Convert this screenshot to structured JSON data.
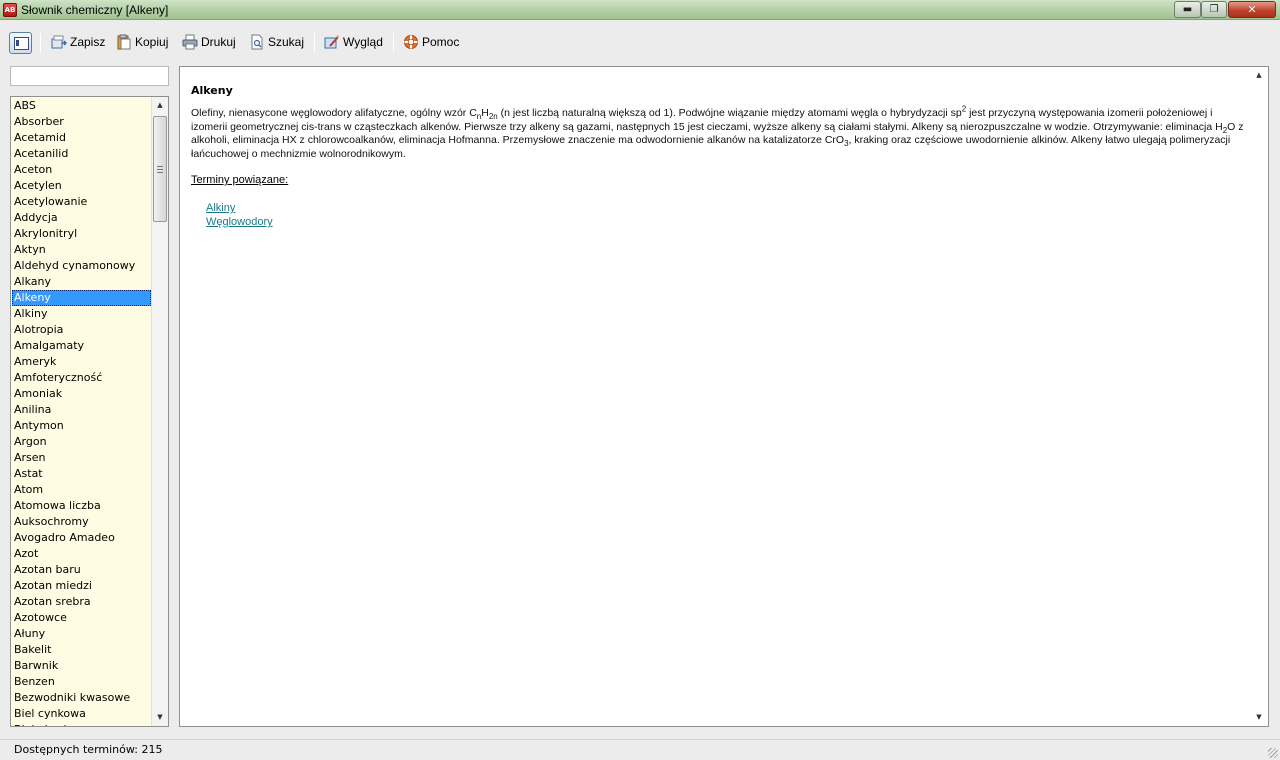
{
  "window": {
    "app_icon_text": "AB",
    "title": "Słownik chemiczny [Alkeny]",
    "min_glyph": "▬",
    "max_glyph": "❐",
    "close_glyph": "✕"
  },
  "toolbar": {
    "save": "Zapisz",
    "copy": "Kopiuj",
    "print": "Drukuj",
    "search": "Szukaj",
    "view": "Wygląd",
    "help": "Pomoc"
  },
  "search": {
    "value": ""
  },
  "terms": [
    "ABS",
    "Absorber",
    "Acetamid",
    "Acetanilid",
    "Aceton",
    "Acetylen",
    "Acetylowanie",
    "Addycja",
    "Akrylonitryl",
    "Aktyn",
    "Aldehyd cynamonowy",
    "Alkany",
    "Alkeny",
    "Alkiny",
    "Alotropia",
    "Amalgamaty",
    "Ameryk",
    "Amfoteryczność",
    "Amoniak",
    "Anilina",
    "Antymon",
    "Argon",
    "Arsen",
    "Astat",
    "Atom",
    "Atomowa liczba",
    "Auksochromy",
    "Avogadro Amadeo",
    "Azot",
    "Azotan baru",
    "Azotan miedzi",
    "Azotan srebra",
    "Azotowce",
    "Ałuny",
    "Bakelit",
    "Barwnik",
    "Benzen",
    "Bezwodniki kwasowe",
    "Biel cynkowa",
    "Biel ołowiana"
  ],
  "selected_term": "Alkeny",
  "article": {
    "heading": "Alkeny",
    "p1": "Olefiny, nienasycone węglowodory alifatyczne, ogólny wzór C",
    "p1_sub1": "n",
    "p1_b": "H",
    "p1_sub2": "2n",
    "p1_c": " (n jest liczbą naturalną większą od 1). Podwójne wiązanie między atomami węgla o hybrydyzacji sp",
    "p1_sup": "2",
    "p1_d": " jest przyczyną występowania izomerii położeniowej i izomerii geometrycznej cis-trans w cząsteczkach alkenów. Pierwsze trzy alkeny są gazami, następnych 15 jest cieczami, wyższe alkeny są ciałami stałymi. Alkeny są nierozpuszczalne w wodzie. Otrzymywanie: eliminacja H",
    "p1_sub3": "2",
    "p1_e": "O z alkoholi, eliminacja HX z chlorowcoalkanów, eliminacja Hofmanna. Przemysłowe znaczenie ma odwodornienie alkanów na katalizatorze CrO",
    "p1_sub4": "3",
    "p1_f": ", kraking oraz częściowe uwodornienie alkinów. Alkeny łatwo ulegają polimeryzacji łańcuchowej o mechnizmie wolnorodnikowym.",
    "related_label": "Terminy powiązane:",
    "related": [
      "Alkiny",
      "Węglowodory"
    ]
  },
  "status": {
    "text": "Dostępnych terminów: 215"
  },
  "scroll": {
    "up_glyph": "▲",
    "down_glyph": "▼"
  }
}
